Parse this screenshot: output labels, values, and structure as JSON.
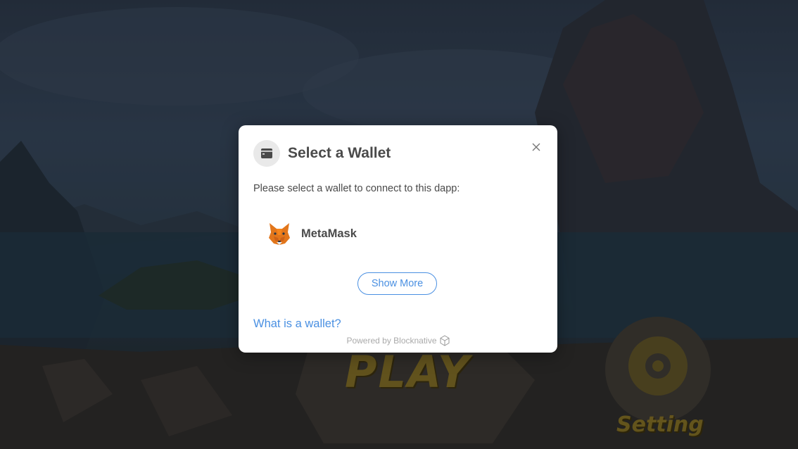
{
  "background": {
    "play_label": "PLAY",
    "setting_label": "Setting"
  },
  "modal": {
    "header_icon": "wallet-icon",
    "title": "Select a Wallet",
    "close_icon": "close-icon",
    "subtitle": "Please select a wallet to connect to this dapp:",
    "wallets": [
      {
        "label": "MetaMask",
        "icon": "metamask-fox-icon"
      }
    ],
    "show_more_label": "Show More",
    "help_link_label": "What is a wallet?",
    "powered_by": "Powered by Blocknative",
    "powered_by_icon": "blocknative-logo-icon"
  },
  "colors": {
    "accent": "#4a90e2",
    "text": "#4a4a4a",
    "muted": "#aaaaaa",
    "modal_bg": "#ffffff"
  }
}
